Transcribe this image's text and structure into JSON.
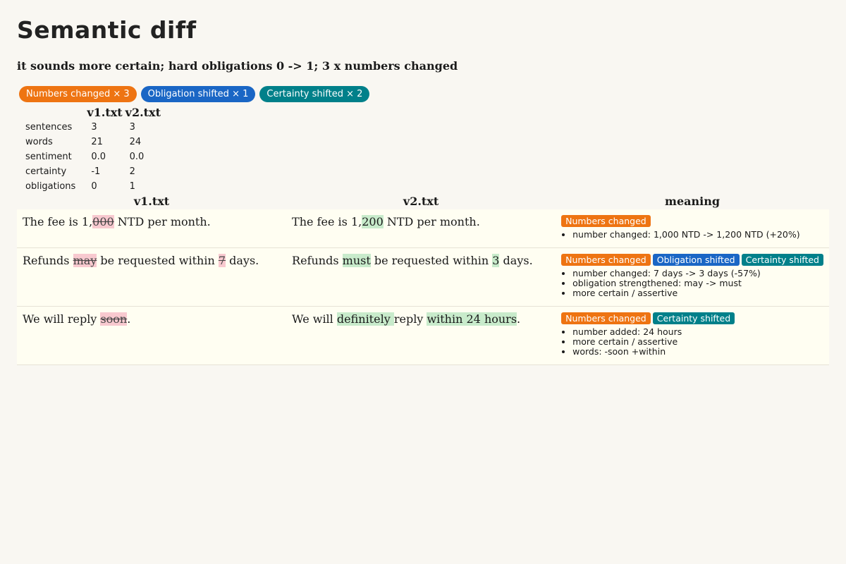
{
  "title": "Semantic diff",
  "summary": "it sounds more certain; hard obligations 0 -> 1; 3 x numbers changed",
  "badges": [
    {
      "label": "Numbers changed × 3",
      "color": "#ee7412"
    },
    {
      "label": "Obligation shifted × 1",
      "color": "#1a66c5"
    },
    {
      "label": "Certainty shifted × 2",
      "color": "#00808a"
    }
  ],
  "stats": {
    "headers": [
      "",
      "v1.txt",
      "v2.txt"
    ],
    "rows": [
      {
        "label": "sentences",
        "v1": "3",
        "v2": "3"
      },
      {
        "label": "words",
        "v1": "21",
        "v2": "24"
      },
      {
        "label": "sentiment",
        "v1": "0.0",
        "v2": "0.0"
      },
      {
        "label": "certainty",
        "v1": "-1",
        "v2": "2"
      },
      {
        "label": "obligations",
        "v1": "0",
        "v2": "1"
      }
    ]
  },
  "diff": {
    "headers": [
      "v1.txt",
      "v2.txt",
      "meaning"
    ],
    "rows": [
      {
        "v1": [
          {
            "t": "The fee is 1,"
          },
          {
            "t": "000",
            "k": "del"
          },
          {
            "t": " NTD per month."
          }
        ],
        "v2": [
          {
            "t": "The fee is 1,"
          },
          {
            "t": "200",
            "k": "ins"
          },
          {
            "t": " NTD per month."
          }
        ],
        "tags": [
          "Numbers changed"
        ],
        "notes": [
          "number changed: 1,000 NTD -> 1,200 NTD (+20%)"
        ]
      },
      {
        "v1": [
          {
            "t": "Refunds "
          },
          {
            "t": "may",
            "k": "del"
          },
          {
            "t": " be requested within "
          },
          {
            "t": "7",
            "k": "del"
          },
          {
            "t": " days."
          }
        ],
        "v2": [
          {
            "t": "Refunds "
          },
          {
            "t": "must",
            "k": "ins"
          },
          {
            "t": " be requested within "
          },
          {
            "t": "3",
            "k": "ins"
          },
          {
            "t": " days."
          }
        ],
        "tags": [
          "Numbers changed",
          "Obligation shifted",
          "Certainty shifted"
        ],
        "notes": [
          "number changed: 7 days -> 3 days (-57%)",
          "obligation strengthened: may -> must",
          "more certain / assertive"
        ]
      },
      {
        "v1": [
          {
            "t": "We will reply "
          },
          {
            "t": "soon",
            "k": "del"
          },
          {
            "t": "."
          }
        ],
        "v2": [
          {
            "t": "We will "
          },
          {
            "t": "definitely ",
            "k": "ins"
          },
          {
            "t": "reply "
          },
          {
            "t": "within 24 hours",
            "k": "ins"
          },
          {
            "t": "."
          }
        ],
        "tags": [
          "Numbers changed",
          "Certainty shifted"
        ],
        "notes": [
          "number added: 24 hours",
          "more certain / assertive",
          "words: -soon +within"
        ]
      }
    ]
  },
  "tag_colors": {
    "Numbers changed": "#ee7412",
    "Obligation shifted": "#1a66c5",
    "Certainty shifted": "#00808a"
  }
}
